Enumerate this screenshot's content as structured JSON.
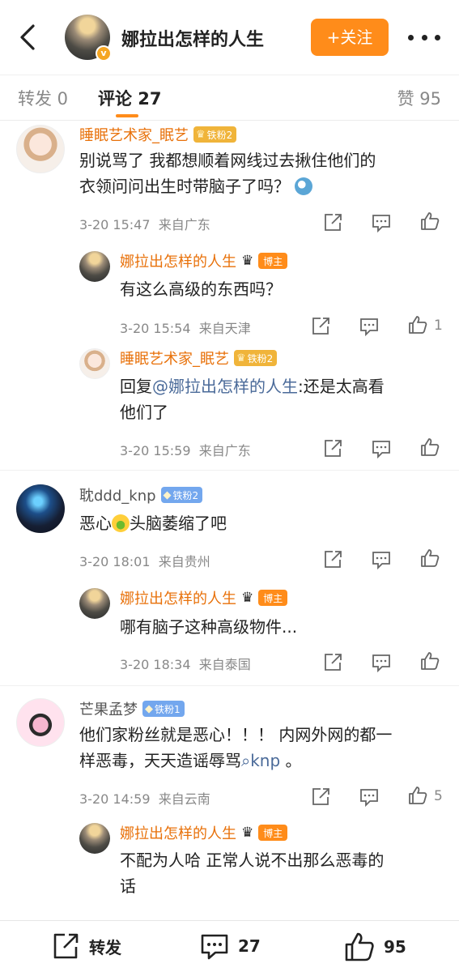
{
  "header": {
    "back_icon": "chevron-left-icon",
    "title": "娜拉出怎样的人生",
    "follow_label": "+关注",
    "more_icon": "more-dots-icon",
    "accent": "#ff8c1a"
  },
  "tabs": {
    "repost": "转发 0",
    "comments": "评论 27",
    "likes": "赞 95"
  },
  "comments": [
    {
      "user": "睡眠艺术家_眠艺",
      "fan_badge": "铁粉2",
      "text": [
        "别说骂了 我都想顺着网线过去揪住他们的",
        "衣领问问出生时带脑子了吗？"
      ],
      "time": "3-20 15:47",
      "location": "来自广东",
      "likes": ""
    },
    {
      "user": "娜拉出怎样的人生",
      "host_badge": "博主",
      "text": [
        "有这么高级的东西吗？"
      ],
      "time": "3-20 15:54",
      "location": "来自天津",
      "likes": "1"
    },
    {
      "user": "睡眠艺术家_眠艺",
      "fan_badge": "铁粉2",
      "reply_prefix": "回复",
      "reply_at": "@娜拉出怎样的人生",
      "reply_rest": ":还是太高看",
      "text_line2": "他们了",
      "time": "3-20 15:59",
      "location": "来自广东",
      "likes": ""
    },
    {
      "user": "耽ddd_knp",
      "fan_badge": "铁粉2",
      "text_a": "恶心",
      "text_b": "头脑萎缩了吧",
      "time": "3-20 18:01",
      "location": "来自贵州",
      "likes": ""
    },
    {
      "user": "娜拉出怎样的人生",
      "host_badge": "博主",
      "text": [
        "哪有脑子这种高级物件..."
      ],
      "time": "3-20 18:34",
      "location": "来自泰国",
      "likes": ""
    },
    {
      "user": "芒果孟梦",
      "fan_badge": "铁粉1",
      "text_line1": "他们家粉丝就是恶心！！！ 内网外网的都一",
      "text_line2_a": "样恶毒，天天造谣辱骂",
      "search_link": "knp",
      "text_line2_b": "。",
      "time": "3-20 14:59",
      "location": "来自云南",
      "likes": "5"
    },
    {
      "user": "娜拉出怎样的人生",
      "host_badge": "博主",
      "text": [
        "不配为人哈 正常人说不出那么恶毒的",
        "话"
      ],
      "time": "",
      "location": "",
      "likes": ""
    }
  ],
  "bottom_bar": {
    "repost_label": "转发",
    "comment_count": "27",
    "like_count": "95"
  }
}
